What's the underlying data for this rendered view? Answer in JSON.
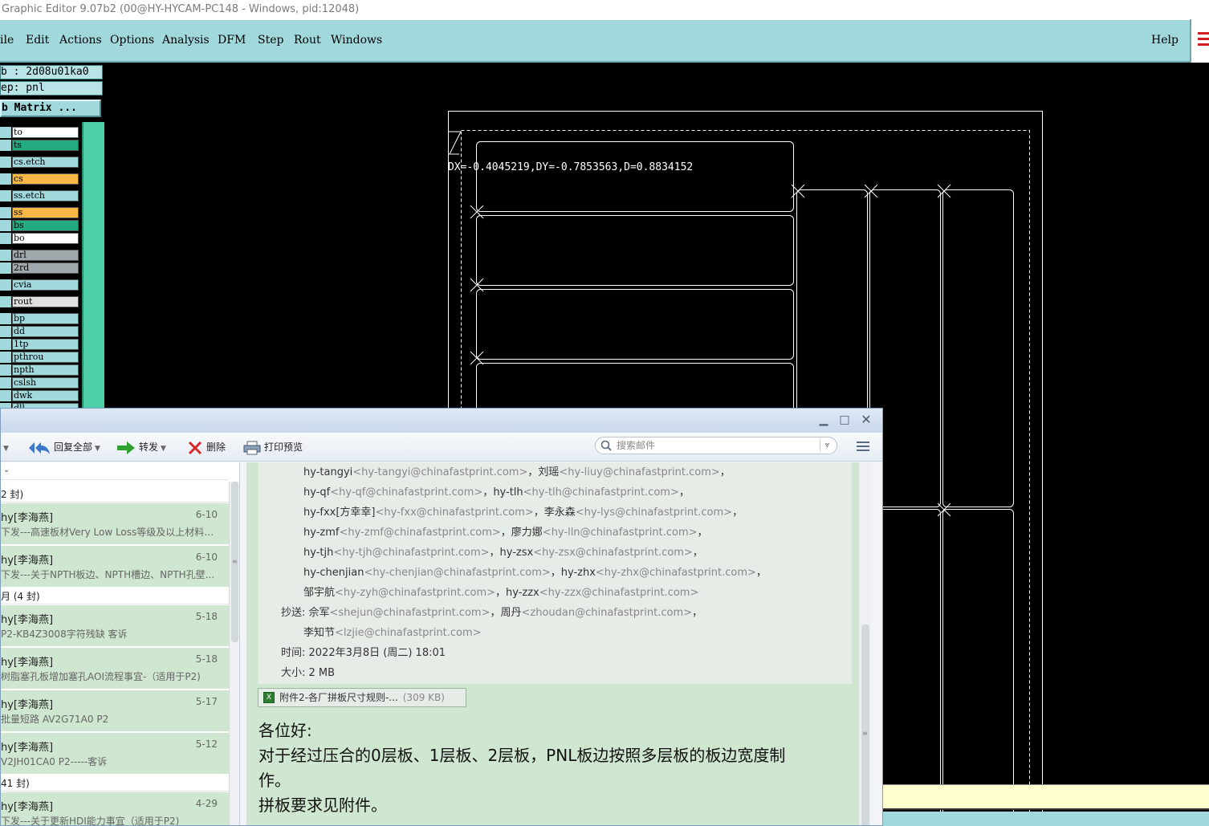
{
  "editor": {
    "title": "Graphic Editor 9.07b2 (00@HY-HYCAM-PC148 - Windows, pid:12048)",
    "menu": [
      "ile",
      "Edit",
      "Actions",
      "Options",
      "Analysis",
      "DFM",
      "Step",
      "Rout",
      "Windows"
    ],
    "help": "Help",
    "job_label": "b : 2d08u01ka0",
    "step_label": "ep: pnl",
    "matrix_button": "b Matrix ...",
    "layers": [
      {
        "name": "to",
        "color": "#ffffff"
      },
      {
        "name": "ts",
        "color": "#22aa80"
      },
      {
        "name": "cs.etch",
        "color": "#a0d8dc"
      },
      {
        "name": "cs",
        "color": "#f8b848"
      },
      {
        "name": "ss.etch",
        "color": "#a0d8dc"
      },
      {
        "name": "ss",
        "color": "#f8b848"
      },
      {
        "name": "bs",
        "color": "#22aa80"
      },
      {
        "name": "bo",
        "color": "#ffffff"
      },
      {
        "name": "drl",
        "color": "#a0a8ac"
      },
      {
        "name": "2rd",
        "color": "#a0a8ac"
      },
      {
        "name": "cvia",
        "color": "#a0d8dc"
      },
      {
        "name": "rout",
        "color": "#e0e0e0"
      },
      {
        "name": "bp",
        "color": "#a0d8dc"
      },
      {
        "name": "dd",
        "color": "#a0d8dc"
      },
      {
        "name": "1tp",
        "color": "#a0d8dc"
      },
      {
        "name": "pthrou",
        "color": "#a0d8dc"
      },
      {
        "name": "npth",
        "color": "#a0d8dc"
      },
      {
        "name": "cslsh",
        "color": "#a0d8dc"
      },
      {
        "name": "dwk",
        "color": "#a0d8dc"
      },
      {
        "name": "dll",
        "color": "#a0d8dc"
      }
    ],
    "measure": "DX=-0.4045219,DY=-0.7853563,D=0.8834152"
  },
  "mail": {
    "toolbar": {
      "reply_all": "回复全部",
      "forward": "转发",
      "delete": "删除",
      "print_preview": "打印预览",
      "search_placeholder": "搜索邮件"
    },
    "groups": [
      "2 封)",
      "月 (4 封)",
      "41 封)"
    ],
    "messages": [
      {
        "from": "hy[李海燕]",
        "date": "6-10",
        "subject": "下发---高速板材Very Low Loss等级及以上材料机..."
      },
      {
        "from": "hy[李海燕]",
        "date": "6-10",
        "subject": "下发---关于NPTH板边、NPTH槽边、NPTH孔壁..."
      },
      {
        "from": "hy[李海燕]",
        "date": "5-18",
        "subject": "P2-KB4Z3008字符残缺  客诉"
      },
      {
        "from": "hy[李海燕]",
        "date": "5-18",
        "subject": "树脂塞孔板增加塞孔AOI流程事宜-（适用于P2)"
      },
      {
        "from": "hy[李海燕]",
        "date": "5-17",
        "subject": "批量短路   AV2G71A0   P2"
      },
      {
        "from": "hy[李海燕]",
        "date": "5-12",
        "subject": "V2JH01CA0    P2-----客诉"
      },
      {
        "from": "hy[李海燕]",
        "date": "4-29",
        "subject": "下发---关于更新HDI能力事宜（适用于P2)"
      }
    ],
    "header_lines": [
      [
        {
          "t": "hy-tangyi",
          "e": "<hy-tangyi@chinafastprint.com>"
        },
        {
          "t": "，刘瑶",
          "e": "<hy-liuy@chinafastprint.com>"
        },
        {
          "t": "，",
          "e": ""
        }
      ],
      [
        {
          "t": "hy-qf",
          "e": "<hy-qf@chinafastprint.com>"
        },
        {
          "t": "，hy-tlh",
          "e": "<hy-tlh@chinafastprint.com>"
        },
        {
          "t": "，",
          "e": ""
        }
      ],
      [
        {
          "t": "hy-fxx[方幸幸]",
          "e": "<hy-fxx@chinafastprint.com>"
        },
        {
          "t": "，李永森",
          "e": "<hy-lys@chinafastprint.com>"
        },
        {
          "t": "，",
          "e": ""
        }
      ],
      [
        {
          "t": "hy-zmf",
          "e": "<hy-zmf@chinafastprint.com>"
        },
        {
          "t": "，廖力娜",
          "e": "<hy-lln@chinafastprint.com>"
        },
        {
          "t": "，",
          "e": ""
        }
      ],
      [
        {
          "t": "hy-tjh",
          "e": "<hy-tjh@chinafastprint.com>"
        },
        {
          "t": "，hy-zsx",
          "e": "<hy-zsx@chinafastprint.com>"
        },
        {
          "t": "，",
          "e": ""
        }
      ],
      [
        {
          "t": "hy-chenjian",
          "e": "<hy-chenjian@chinafastprint.com>"
        },
        {
          "t": "，hy-zhx",
          "e": "<hy-zhx@chinafastprint.com>"
        },
        {
          "t": "，",
          "e": ""
        }
      ],
      [
        {
          "t": "邹宇航",
          "e": "<hy-zyh@chinafastprint.com>"
        },
        {
          "t": "，hy-zzx",
          "e": "<hy-zzx@chinafastprint.com>"
        },
        {
          "t": "",
          "e": ""
        }
      ]
    ],
    "cc_label": "抄送: 佘军",
    "cc_first": [
      {
        "t": "",
        "e": "<shejun@chinafastprint.com>"
      },
      {
        "t": "，周丹",
        "e": "<zhoudan@chinafastprint.com>"
      },
      {
        "t": "，",
        "e": ""
      }
    ],
    "cc_second": [
      {
        "t": "李知节",
        "e": "<lzjie@chinafastprint.com>"
      }
    ],
    "time_line": "时间: 2022年3月8日 (周二) 18:01",
    "size_line": "大小: 2 MB",
    "attachment": {
      "name": "附件2-各厂拼板尺寸规则-...",
      "size": "(309 KB)"
    },
    "body": [
      "各位好:",
      "    对于经过压合的0层板、1层板、2层板，PNL板边按照多层板的板边宽度制",
      "作。",
      "    拼板要求见附件。"
    ]
  }
}
